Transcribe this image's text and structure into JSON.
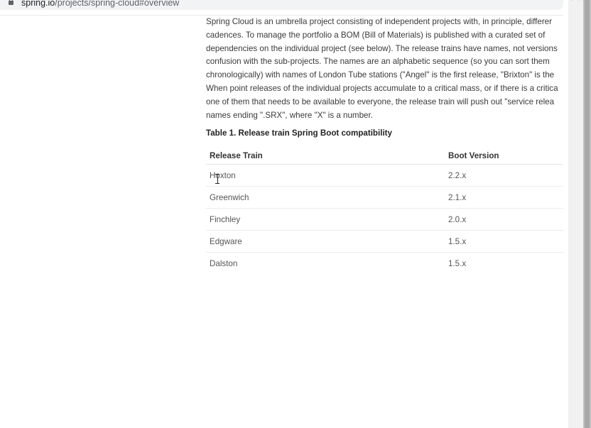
{
  "browser": {
    "url_host": "spring.io",
    "url_path": "/projects/spring-cloud#overview"
  },
  "content": {
    "intro_lines": [
      "Spring Cloud is an umbrella project consisting of independent projects with, in principle, differer",
      "cadences. To manage the portfolio a BOM (Bill of Materials) is published with a curated set of",
      "dependencies on the individual project (see below). The release trains have names, not versions",
      "confusion with the sub-projects. The names are an alphabetic sequence (so you can sort them",
      "chronologically) with names of London Tube stations (\"Angel\" is the first release, \"Brixton\" is the",
      "When point releases of the individual projects accumulate to a critical mass, or if there is a critica",
      "one of them that needs to be available to everyone, the release train will push out \"service relea",
      "names ending \".SRX\", where \"X\" is a number."
    ],
    "table_caption": "Table 1. Release train Spring Boot compatibility",
    "table": {
      "headers": [
        "Release Train",
        "Boot Version"
      ],
      "rows": [
        [
          "Hoxton",
          "2.2.x"
        ],
        [
          "Greenwich",
          "2.1.x"
        ],
        [
          "Finchley",
          "2.0.x"
        ],
        [
          "Edgware",
          "1.5.x"
        ],
        [
          "Dalston",
          "1.5.x"
        ]
      ]
    }
  }
}
